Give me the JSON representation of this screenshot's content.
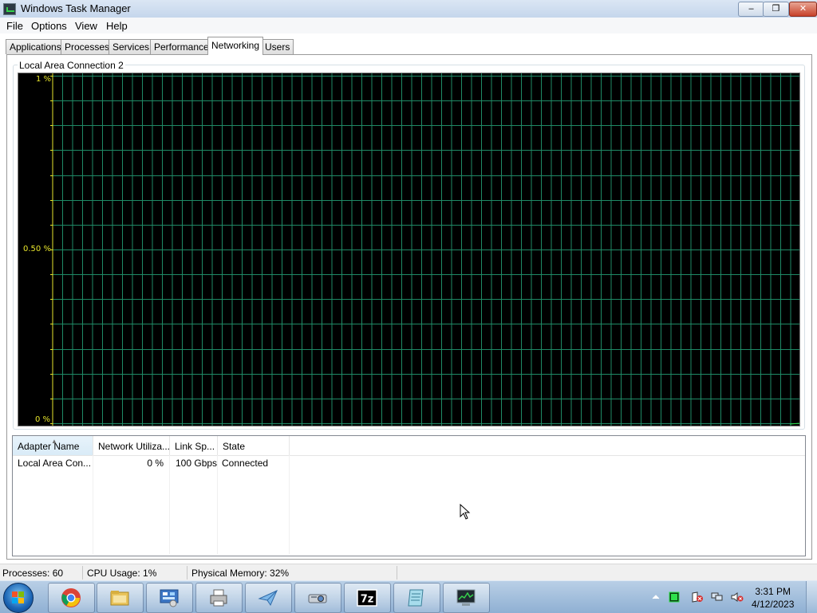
{
  "window": {
    "title": "Windows Task Manager",
    "buttons": {
      "minimize": "‒",
      "maximize": "❐",
      "close": "✕"
    }
  },
  "menu": [
    "File",
    "Options",
    "View",
    "Help"
  ],
  "tabs": [
    {
      "label": "Applications"
    },
    {
      "label": "Processes"
    },
    {
      "label": "Services"
    },
    {
      "label": "Performance"
    },
    {
      "label": "Networking",
      "active": true
    },
    {
      "label": "Users"
    }
  ],
  "networking": {
    "group_label": "Local Area Connection 2",
    "graph": {
      "top_label": "1 %",
      "mid_label": "0.50 %",
      "bottom_label": "0 %",
      "grid_color": "#1f8a66",
      "axis_color": "#e8e62c"
    },
    "columns": [
      "Adapter Name",
      "Network Utiliza...",
      "Link Sp...",
      "State"
    ],
    "rows": [
      {
        "adapter": "Local Area Con...",
        "utilization": "0 %",
        "link_speed": "100 Gbps",
        "state": "Connected"
      }
    ]
  },
  "status": {
    "processes": "Processes: 60",
    "cpu": "CPU Usage: 1%",
    "memory": "Physical Memory: 32%"
  },
  "taskbar": {
    "apps": [
      "chrome-icon",
      "file-explorer-icon",
      "control-panel-icon",
      "printer-icon",
      "mail-icon",
      "projector-icon",
      "7zip-icon",
      "notepad-icon",
      "task-manager-icon"
    ],
    "clock_time": "3:31 PM",
    "clock_date": "4/12/2023"
  }
}
